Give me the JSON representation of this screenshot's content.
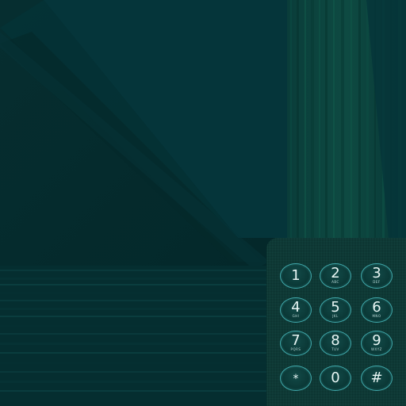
{
  "colors": {
    "background_dark": "#032a2c",
    "panel_teal": "#05353a",
    "key_border": "#3fa7a9",
    "key_text": "#e8f6f4"
  },
  "keypad": {
    "keys": [
      {
        "digit": "1",
        "letters": ""
      },
      {
        "digit": "2",
        "letters": "ABC"
      },
      {
        "digit": "3",
        "letters": "DEF"
      },
      {
        "digit": "4",
        "letters": "GHI"
      },
      {
        "digit": "5",
        "letters": "JKL"
      },
      {
        "digit": "6",
        "letters": "MNO"
      },
      {
        "digit": "7",
        "letters": "PQRS"
      },
      {
        "digit": "8",
        "letters": "TUV"
      },
      {
        "digit": "9",
        "letters": "WXYZ"
      },
      {
        "digit": "*",
        "letters": ""
      },
      {
        "digit": "0",
        "letters": ""
      },
      {
        "digit": "#",
        "letters": ""
      }
    ]
  }
}
